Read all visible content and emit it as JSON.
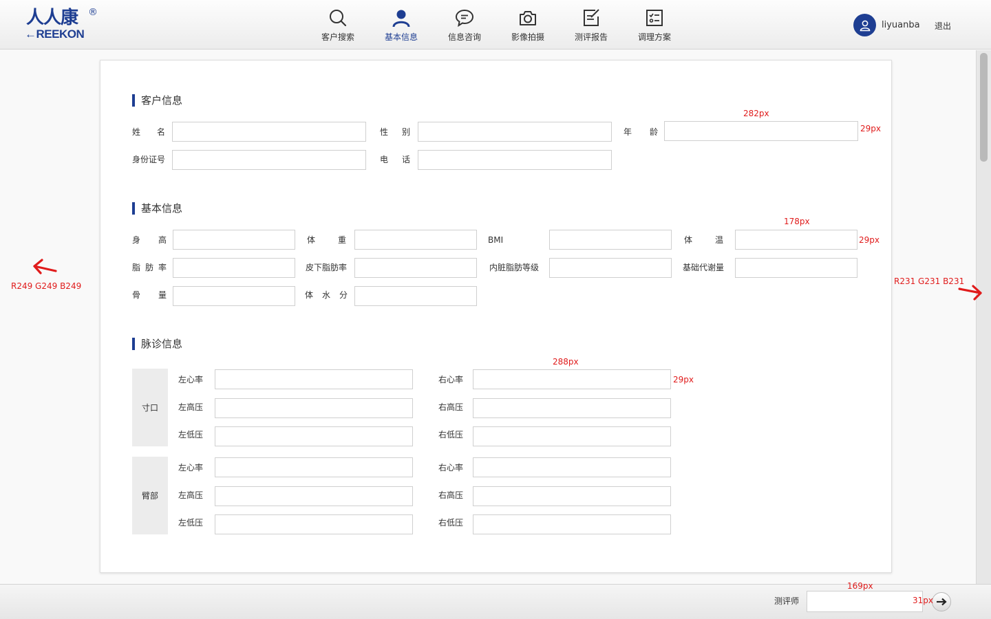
{
  "header": {
    "logo_cn": "人人康",
    "logo_reg": "®",
    "logo_en": "REEKON",
    "nav": [
      {
        "label": "客户搜索",
        "icon": "search-icon"
      },
      {
        "label": "基本信息",
        "icon": "user-icon",
        "active": true
      },
      {
        "label": "信息咨询",
        "icon": "chat-bubble-icon"
      },
      {
        "label": "影像拍摄",
        "icon": "camera-icon"
      },
      {
        "label": "测评报告",
        "icon": "report-edit-icon"
      },
      {
        "label": "调理方案",
        "icon": "checklist-icon"
      }
    ],
    "username": "liyuanba",
    "logout": "退出"
  },
  "sections": {
    "customer": {
      "title": "客户信息",
      "name": "姓　名",
      "gender": "性　别",
      "age": "年　龄",
      "id_number": "身份证号",
      "phone": "电　话"
    },
    "basic": {
      "title": "基本信息",
      "height": "身　高",
      "weight": "体　重",
      "bmi": "BMI",
      "temperature": "体　温",
      "body_fat": "脂肪率",
      "subcutaneous_fat": "皮下脂肪率",
      "visceral_fat": "内脏脂肪等级",
      "bmr": "基础代谢量",
      "bone_mass": "骨　量",
      "body_water": "体水分"
    },
    "pulse": {
      "title": "脉诊信息",
      "groups": [
        {
          "name": "寸口",
          "left": [
            "左心率",
            "左高压",
            "左低压"
          ],
          "right": [
            "右心率",
            "右高压",
            "右低压"
          ]
        },
        {
          "name": "臂部",
          "left": [
            "左心率",
            "左高压",
            "左低压"
          ],
          "right": [
            "右心率",
            "右高压",
            "右低压"
          ]
        }
      ]
    }
  },
  "footer": {
    "evaluator_label": "测评师",
    "evaluator_value": ""
  },
  "annotations": {
    "w282": "282px",
    "h29_a": "29px",
    "w178": "178px",
    "h29_b": "29px",
    "w288": "288px",
    "h29_c": "29px",
    "w169": "169px",
    "h31": "31px",
    "bg_left": "R249  G249  B249",
    "bg_right": "R231  G231  B231"
  },
  "colors": {
    "accent": "#1e3e92",
    "page_bg": "#f9f9f9",
    "side_bg": "#e7e7e7",
    "annotation": "#e01b1b"
  }
}
